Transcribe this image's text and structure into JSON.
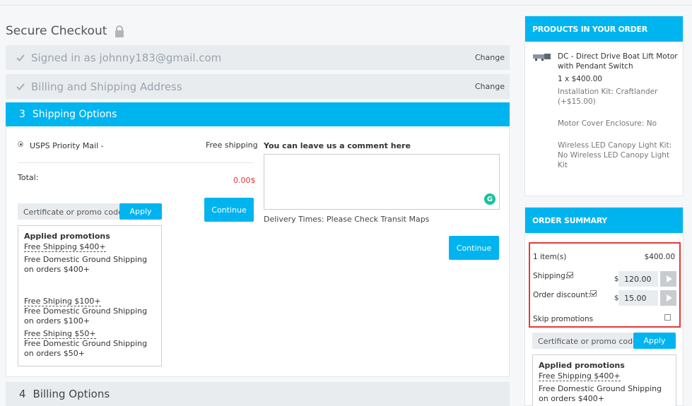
{
  "checkout": {
    "title": "Secure Checkout",
    "steps": {
      "signed_in": {
        "label": "Signed in as johnny183@gmail.com",
        "change": "Change"
      },
      "billing_shipping": {
        "label": "Billing and Shipping Address",
        "change": "Change"
      },
      "shipping": {
        "num": "3",
        "label": "Shipping Options"
      },
      "billing_options": {
        "num": "4",
        "label": "Billing Options"
      }
    },
    "shipping_option": {
      "name": "USPS Priority Mail -",
      "price": "Free shipping",
      "selected": true
    },
    "total": {
      "label": "Total:",
      "value": "0.00$"
    },
    "promo": {
      "placeholder": "Certificate or promo code",
      "apply": "Apply"
    },
    "continue_small": "Continue",
    "continue_main": "Continue",
    "promotions": {
      "heading": "Applied promotions",
      "items": [
        {
          "link": "Free Shipping $400+",
          "desc": "Free Domestic Ground Shipping on orders $400+"
        },
        {
          "link": "Free Shiping $100+",
          "desc": "Free Domestic Ground Shipping on orders $100+"
        },
        {
          "link": "Free Shiping $50+",
          "desc": "Free Domestic Ground Shipping on orders $50+"
        }
      ]
    },
    "comment": {
      "label": "You can leave us a comment here",
      "value": ""
    },
    "delivery_note": "Delivery Times: Please Check Transit Maps"
  },
  "sidebar": {
    "products_heading": "PRODUCTS IN YOUR ORDER",
    "product": {
      "name": "DC - Direct Drive Boat Lift Motor with Pendant Switch",
      "qty_price": "1 x $400.00",
      "options": [
        "Installation Kit: Craftlander (+$15.00)",
        "Motor Cover Enclosure: No",
        "Wireless LED Canopy Light Kit: No Wireless LED Canopy Light Kit"
      ]
    },
    "summary_heading": "ORDER SUMMARY",
    "summary": {
      "items_label": "1 item(s)",
      "items_value": "$400.00",
      "shipping_label": "Shipping:",
      "shipping_checked": true,
      "currency": "$",
      "shipping_value": "120.00",
      "discount_label": "Order discount:",
      "discount_checked": true,
      "discount_value": "15.00",
      "skip_label": "Skip promotions",
      "skip_checked": false
    },
    "promo": {
      "placeholder": "Certificate or promo code",
      "apply": "Apply"
    },
    "promotions": {
      "heading": "Applied promotions",
      "items": [
        {
          "link": "Free Shipping $400+",
          "desc": "Free Domestic Ground Shipping on orders $400+"
        }
      ]
    }
  },
  "colors": {
    "accent": "#00b4f0",
    "error": "#e53935",
    "step_bg": "#e9ecef"
  }
}
